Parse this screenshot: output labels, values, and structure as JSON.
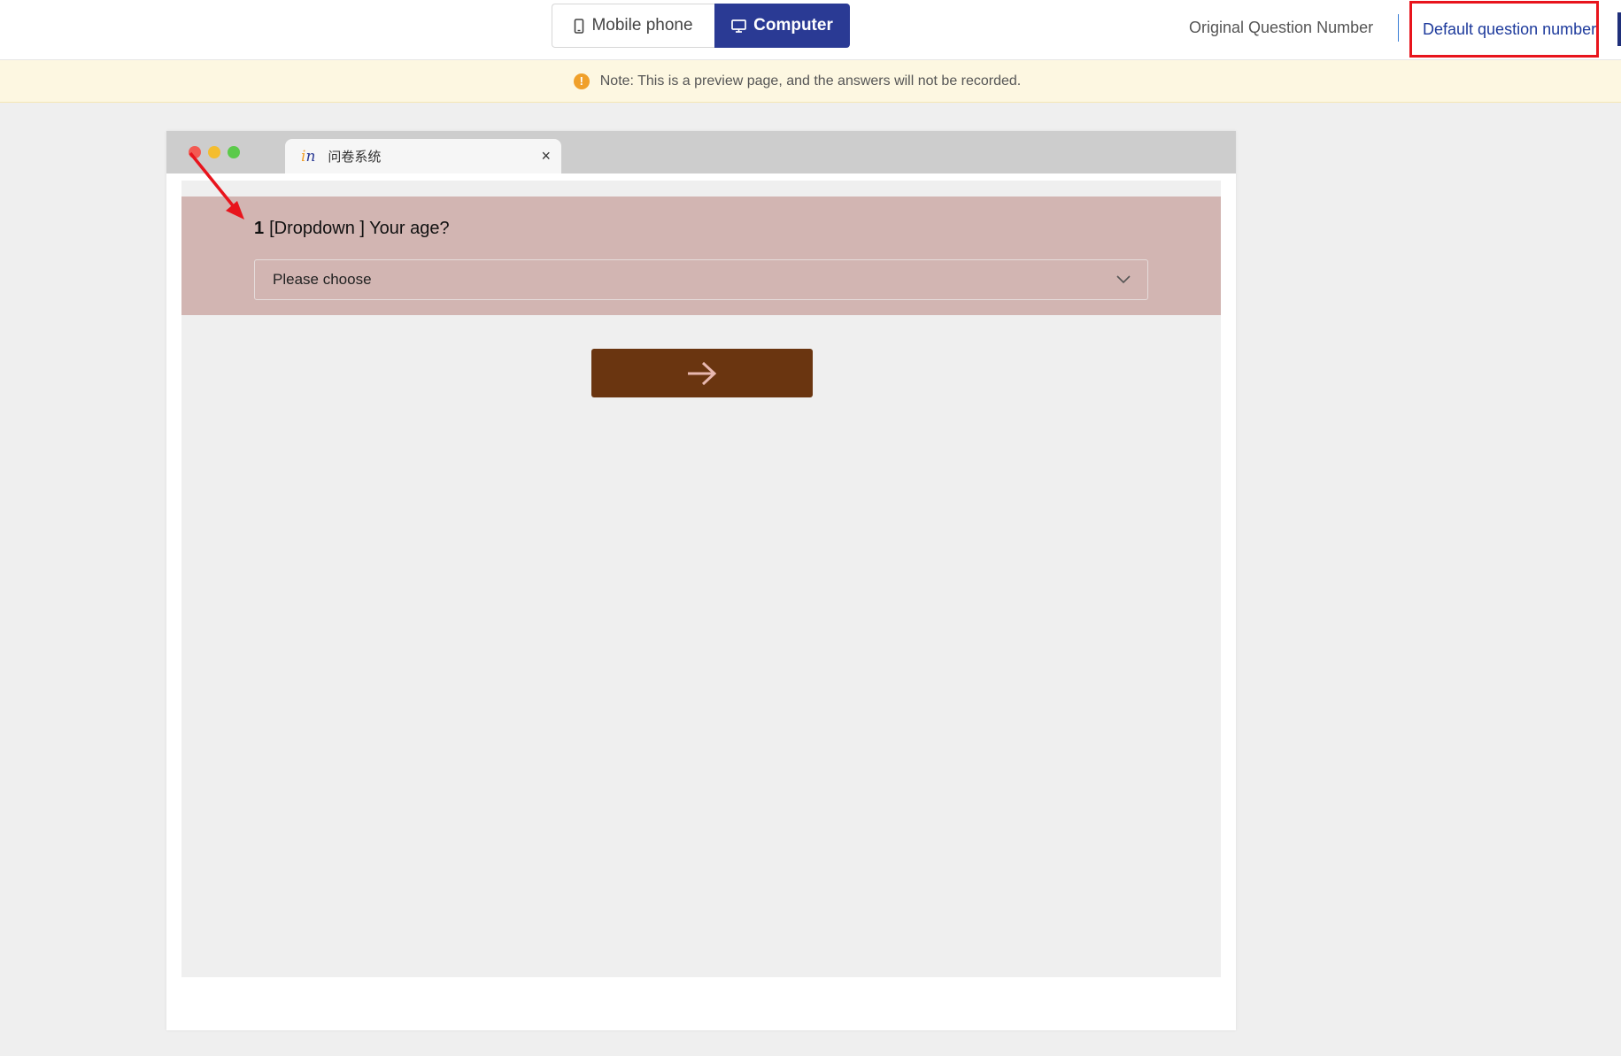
{
  "device_toggle": {
    "mobile_label": "Mobile phone",
    "computer_label": "Computer",
    "selected": "Computer"
  },
  "question_number_mode": {
    "original_label": "Original Question Number",
    "default_label": "Default question number",
    "selected": "Default question number"
  },
  "notice": {
    "text": "Note: This is a preview page, and the answers will not be recorded."
  },
  "browser": {
    "tab_title": "问卷系统",
    "tab_logo_i": "i",
    "tab_logo_n": "n",
    "close_glyph": "×"
  },
  "question": {
    "number": "1",
    "text": "[Dropdown ] Your age?",
    "select_placeholder": "Please choose"
  },
  "colors": {
    "primary": "#2a3a94",
    "question_bg": "#d2b5b2",
    "next_button": "#6a3510",
    "annotation": "#e8141c"
  },
  "icons": {
    "mobile": "mobile-phone-icon",
    "computer": "monitor-icon",
    "warning": "warning-icon",
    "select_chevron": "chevron-down-icon",
    "next": "arrow-right-icon"
  }
}
